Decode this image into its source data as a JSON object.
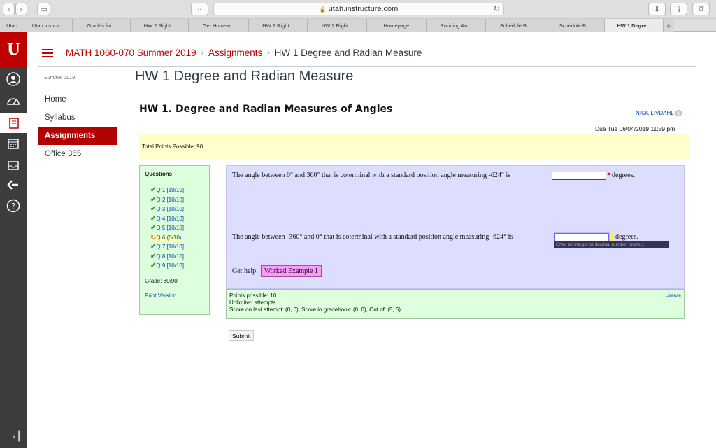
{
  "browser": {
    "url": "utah.instructure.com",
    "tabs": [
      "Utah",
      "Utah.instruc...",
      "Grades for...",
      "HW 2 Right...",
      "Get Homew...",
      "HW 2 Right...",
      "HW 2 Right...",
      "Homepage",
      "Running Au...",
      "Schedule B...",
      "Schedule B...",
      "HW 1 Degre..."
    ],
    "active_tab_index": 11
  },
  "global_nav": {
    "logo": "U",
    "icons": [
      "account-icon",
      "dashboard-icon",
      "courses-icon",
      "calendar-icon",
      "inbox-icon",
      "commons-icon",
      "help-icon"
    ]
  },
  "breadcrumb": {
    "course": "MATH 1060-070 Summer 2019",
    "section": "Assignments",
    "current": "HW 1 Degree and Radian Measure"
  },
  "course_nav": {
    "term": "Summer 2019",
    "items": [
      {
        "label": "Home"
      },
      {
        "label": "Syllabus"
      },
      {
        "label": "Assignments",
        "active": true
      },
      {
        "label": "Office 365"
      }
    ]
  },
  "page_title": "HW 1 Degree and Radian Measure",
  "homework": {
    "title": "HW 1. Degree and Radian Measures of Angles",
    "user": "NICK LIVDAHL",
    "due": "Due Tue 06/04/2019 11:59 pm",
    "total_points": "Total Points Possible: 90",
    "questions_header": "Questions",
    "questions": [
      {
        "label": "Q 1",
        "score": "[10/10]",
        "status": "done"
      },
      {
        "label": "Q 2",
        "score": "[10/10]",
        "status": "done"
      },
      {
        "label": "Q 3",
        "score": "[10/10]",
        "status": "done"
      },
      {
        "label": "Q 4",
        "score": "[10/10]",
        "status": "done"
      },
      {
        "label": "Q 5",
        "score": "[10/10]",
        "status": "done"
      },
      {
        "label": "Q 6",
        "score": "(0/10)",
        "status": "current"
      },
      {
        "label": "Q 7",
        "score": "[10/10]",
        "status": "done"
      },
      {
        "label": "Q 8",
        "score": "[10/10]",
        "status": "done"
      },
      {
        "label": "Q 9",
        "score": "[10/10]",
        "status": "done"
      }
    ],
    "grade": "Grade: 80/90",
    "print_version": "Print Version",
    "q1_text": "The angle between 0° and 360° that is coterminal with a standard position angle measuring -624° is",
    "q1_value": "",
    "q1_unit": "degrees.",
    "q2_text": "The angle between -360° and 0° that is coterminal with a standard position angle measuring -624° is",
    "q2_value": "",
    "q2_unit": "degrees.",
    "q2_hint": "Enter an integer or decimal number [more..]",
    "help_label": "Get help:",
    "help_button": "Worked Example 1",
    "points_possible": "Points possible: 10",
    "attempts": "Unlimited attempts.",
    "last_attempt": "Score on last attempt: (0, 0), Score in gradebook: (0, 0), Out of: (5, 5)",
    "license": "License",
    "submit": "Submit"
  }
}
